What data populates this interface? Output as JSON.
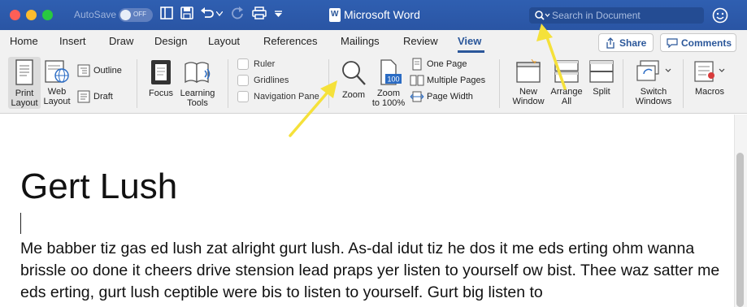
{
  "window": {
    "app_title": "Microsoft Word",
    "autosave_label": "AutoSave",
    "autosave_state": "OFF",
    "search_placeholder": "Search in Document",
    "traffic_lights": [
      "#fd5f57",
      "#febc2e",
      "#28c840"
    ]
  },
  "tabs": [
    "Home",
    "Insert",
    "Draw",
    "Design",
    "Layout",
    "References",
    "Mailings",
    "Review",
    "View"
  ],
  "active_tab": "View",
  "actions": {
    "share": "Share",
    "comments": "Comments"
  },
  "ribbon": {
    "print_layout": "Print\nLayout",
    "web_layout": "Web\nLayout",
    "outline": "Outline",
    "draft": "Draft",
    "focus": "Focus",
    "learning_tools": "Learning\nTools",
    "ruler": "Ruler",
    "gridlines": "Gridlines",
    "navigation_pane": "Navigation Pane",
    "zoom": "Zoom",
    "zoom_100": "Zoom\nto 100%",
    "zoom_100_badge": "100",
    "one_page": "One Page",
    "multiple_pages": "Multiple Pages",
    "page_width": "Page Width",
    "new_window": "New\nWindow",
    "arrange_all": "Arrange\nAll",
    "split": "Split",
    "switch_windows": "Switch\nWindows",
    "macros": "Macros"
  },
  "document": {
    "heading": "Gert Lush",
    "paragraph": "Me babber tiz gas ed lush zat alright gurt lush. As-dal idut tiz he dos it me eds erting ohm wanna brissle oo done it cheers drive stension lead praps yer listen to yourself ow bist. Thee waz satter me eds erting, gurt lush ceptible were bis to listen to yourself. Gurt big listen to"
  },
  "annotation_color": "#f5e13a"
}
